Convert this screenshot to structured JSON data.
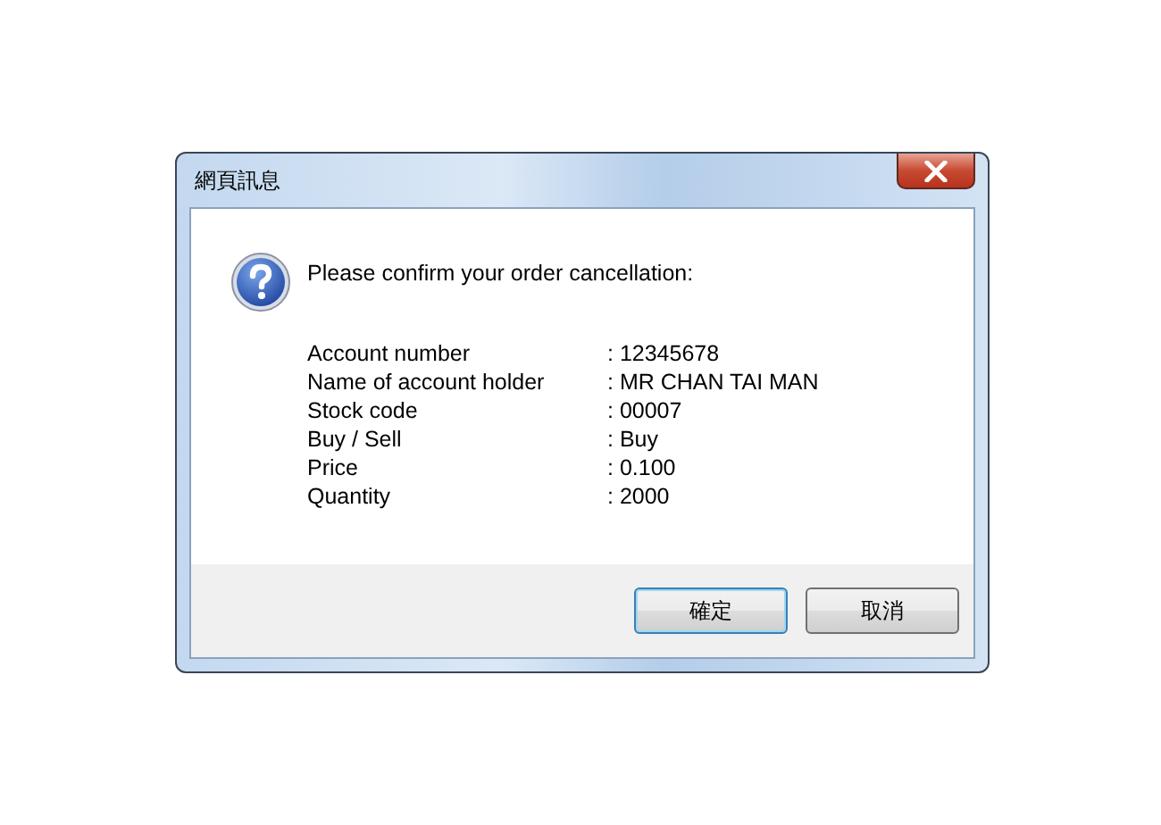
{
  "window": {
    "title": "網頁訊息"
  },
  "message": "Please confirm your order cancellation:",
  "details": [
    {
      "label": "Account number",
      "value": ": 12345678"
    },
    {
      "label": "Name of account holder",
      "value": ": MR CHAN TAI MAN"
    },
    {
      "label": "Stock code",
      "value": ": 00007"
    },
    {
      "label": "Buy / Sell",
      "value": ": Buy"
    },
    {
      "label": "Price",
      "value": ": 0.100"
    },
    {
      "label": "Quantity",
      "value": ": 2000"
    }
  ],
  "buttons": [
    {
      "label": "確定",
      "selected": true
    },
    {
      "label": "取消",
      "selected": false
    }
  ]
}
